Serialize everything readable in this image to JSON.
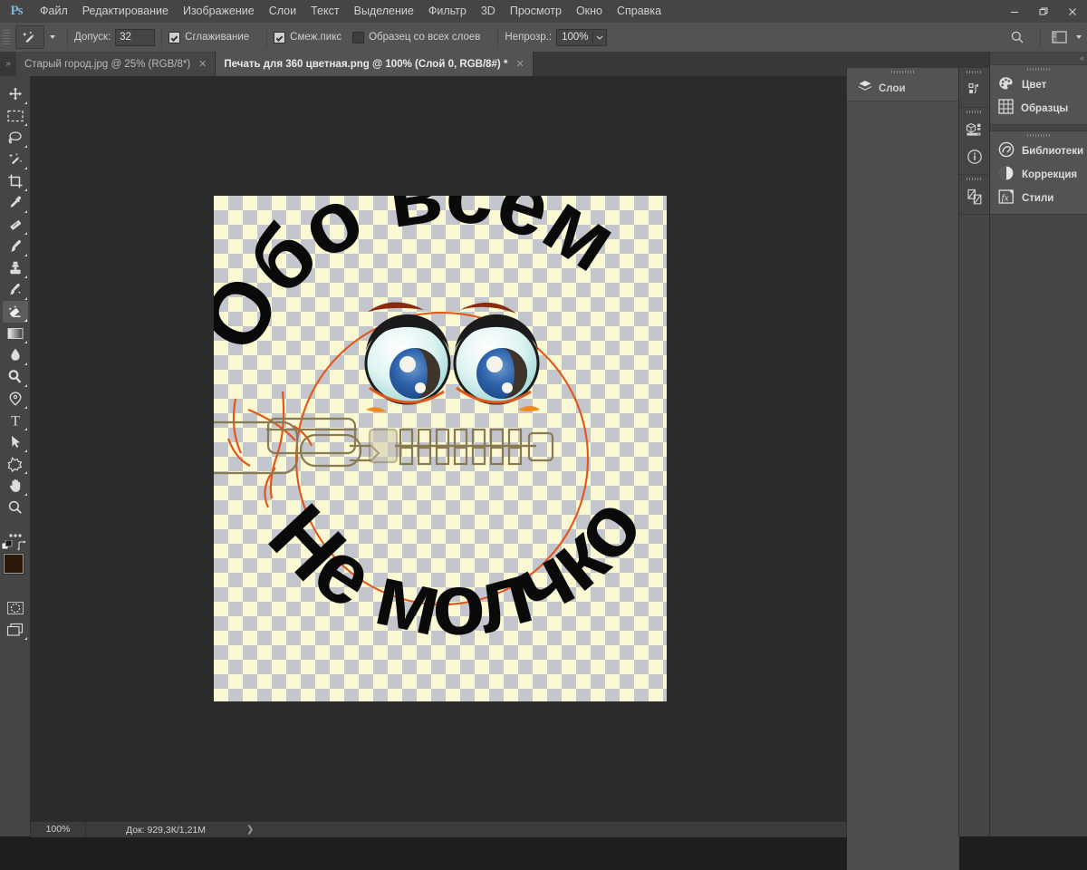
{
  "app": {
    "logo": "Ps",
    "menus": [
      "Файл",
      "Редактирование",
      "Изображение",
      "Слои",
      "Текст",
      "Выделение",
      "Фильтр",
      "3D",
      "Просмотр",
      "Окно",
      "Справка"
    ],
    "window_controls": [
      {
        "name": "minimize-button",
        "glyph": "—"
      },
      {
        "name": "restore-button",
        "glyph": "❐"
      },
      {
        "name": "close-button",
        "glyph": "✕"
      }
    ]
  },
  "options_bar": {
    "tool_icon": "magic-wand-icon",
    "tolerance_label": "Допуск:",
    "tolerance_value": "32",
    "antialias_label": "Сглаживание",
    "antialias_checked": true,
    "contiguous_label": "Смеж.пикс",
    "contiguous_checked": true,
    "all_layers_label": "Образец со всех слоев",
    "all_layers_checked": false,
    "opacity_label": "Непрозр.:",
    "opacity_value": "100%",
    "search_icon": "search-icon",
    "workspace_icon": "workspace-switcher-icon"
  },
  "tabs": [
    {
      "label": "Старый город.jpg @ 25% (RGB/8*)",
      "active": false,
      "close": "✕"
    },
    {
      "label": "Печать для 360 цветная.png @ 100% (Слой 0, RGB/8#) *",
      "active": true,
      "close": "✕"
    }
  ],
  "toolbar": {
    "tools": [
      {
        "name": "move-tool",
        "title": "Перемещение"
      },
      {
        "name": "rectangular-marquee-tool",
        "title": "Прямоугольная область"
      },
      {
        "name": "lasso-tool",
        "title": "Лассо"
      },
      {
        "name": "quick-selection-tool",
        "title": "Быстрое выделение"
      },
      {
        "name": "crop-tool",
        "title": "Рамка"
      },
      {
        "name": "eyedropper-tool",
        "title": "Пипетка"
      },
      {
        "name": "healing-brush-tool",
        "title": "Восстанавливающая кисть"
      },
      {
        "name": "brush-tool",
        "title": "Кисть"
      },
      {
        "name": "clone-stamp-tool",
        "title": "Штамп"
      },
      {
        "name": "history-brush-tool",
        "title": "Архивная кисть"
      },
      {
        "name": "eraser-tool",
        "title": "Ластик",
        "active": true
      },
      {
        "name": "gradient-tool",
        "title": "Градиент"
      },
      {
        "name": "blur-tool",
        "title": "Размытие"
      },
      {
        "name": "dodge-tool",
        "title": "Осветлитель"
      },
      {
        "name": "pen-tool",
        "title": "Перо"
      },
      {
        "name": "type-tool",
        "title": "Текст"
      },
      {
        "name": "path-selection-tool",
        "title": "Выделение контура"
      },
      {
        "name": "shape-tool",
        "title": "Фигура"
      },
      {
        "name": "hand-tool",
        "title": "Рука"
      },
      {
        "name": "zoom-tool",
        "title": "Масштаб"
      },
      {
        "name": "more-tools-button",
        "title": "Редактировать панель инструментов"
      }
    ],
    "foreground_color": "#2b1a08",
    "background_color": "#f5f0cf",
    "quickmask_name": "quick-mask-button",
    "screenmode_name": "screen-mode-button"
  },
  "canvas": {
    "artwork": {
      "top_text": "Обо всем",
      "bottom_text": "Не молчком",
      "face_outline_color": "#e2561a",
      "eyebrow_color": "#8c2a10",
      "iris_color": "#2a5ea8",
      "pupil_color": "#3e342a",
      "sclera_color": "#e8f7f5",
      "zipper_color": "#8a7a52",
      "checker_light": "#faf8d2",
      "checker_dark": "#c3c6cd"
    }
  },
  "status_bar": {
    "zoom": "100%",
    "doc_info": "Док: 929,3К/1,21М",
    "expand_arrow": "❯"
  },
  "layers_panel": {
    "tab_label": "Слои",
    "tab_icon": "layers-icon"
  },
  "icon_column": {
    "groups": [
      [
        {
          "name": "history-icon"
        }
      ],
      [
        {
          "name": "3d-icon"
        },
        {
          "name": "info-icon"
        }
      ],
      [
        {
          "name": "channels-icon"
        }
      ]
    ]
  },
  "right_panel": {
    "collapse_glyph": "«",
    "groups": [
      [
        {
          "name": "color-panel",
          "label": "Цвет",
          "icon": "color-palette-icon"
        },
        {
          "name": "swatches-panel",
          "label": "Образцы",
          "icon": "swatches-grid-icon"
        }
      ],
      [
        {
          "name": "libraries-panel",
          "label": "Библиотеки",
          "icon": "cc-libraries-icon"
        },
        {
          "name": "adjustments-panel",
          "label": "Коррекция",
          "icon": "adjustments-icon"
        },
        {
          "name": "styles-panel",
          "label": "Стили",
          "icon": "fx-styles-icon"
        }
      ]
    ]
  }
}
